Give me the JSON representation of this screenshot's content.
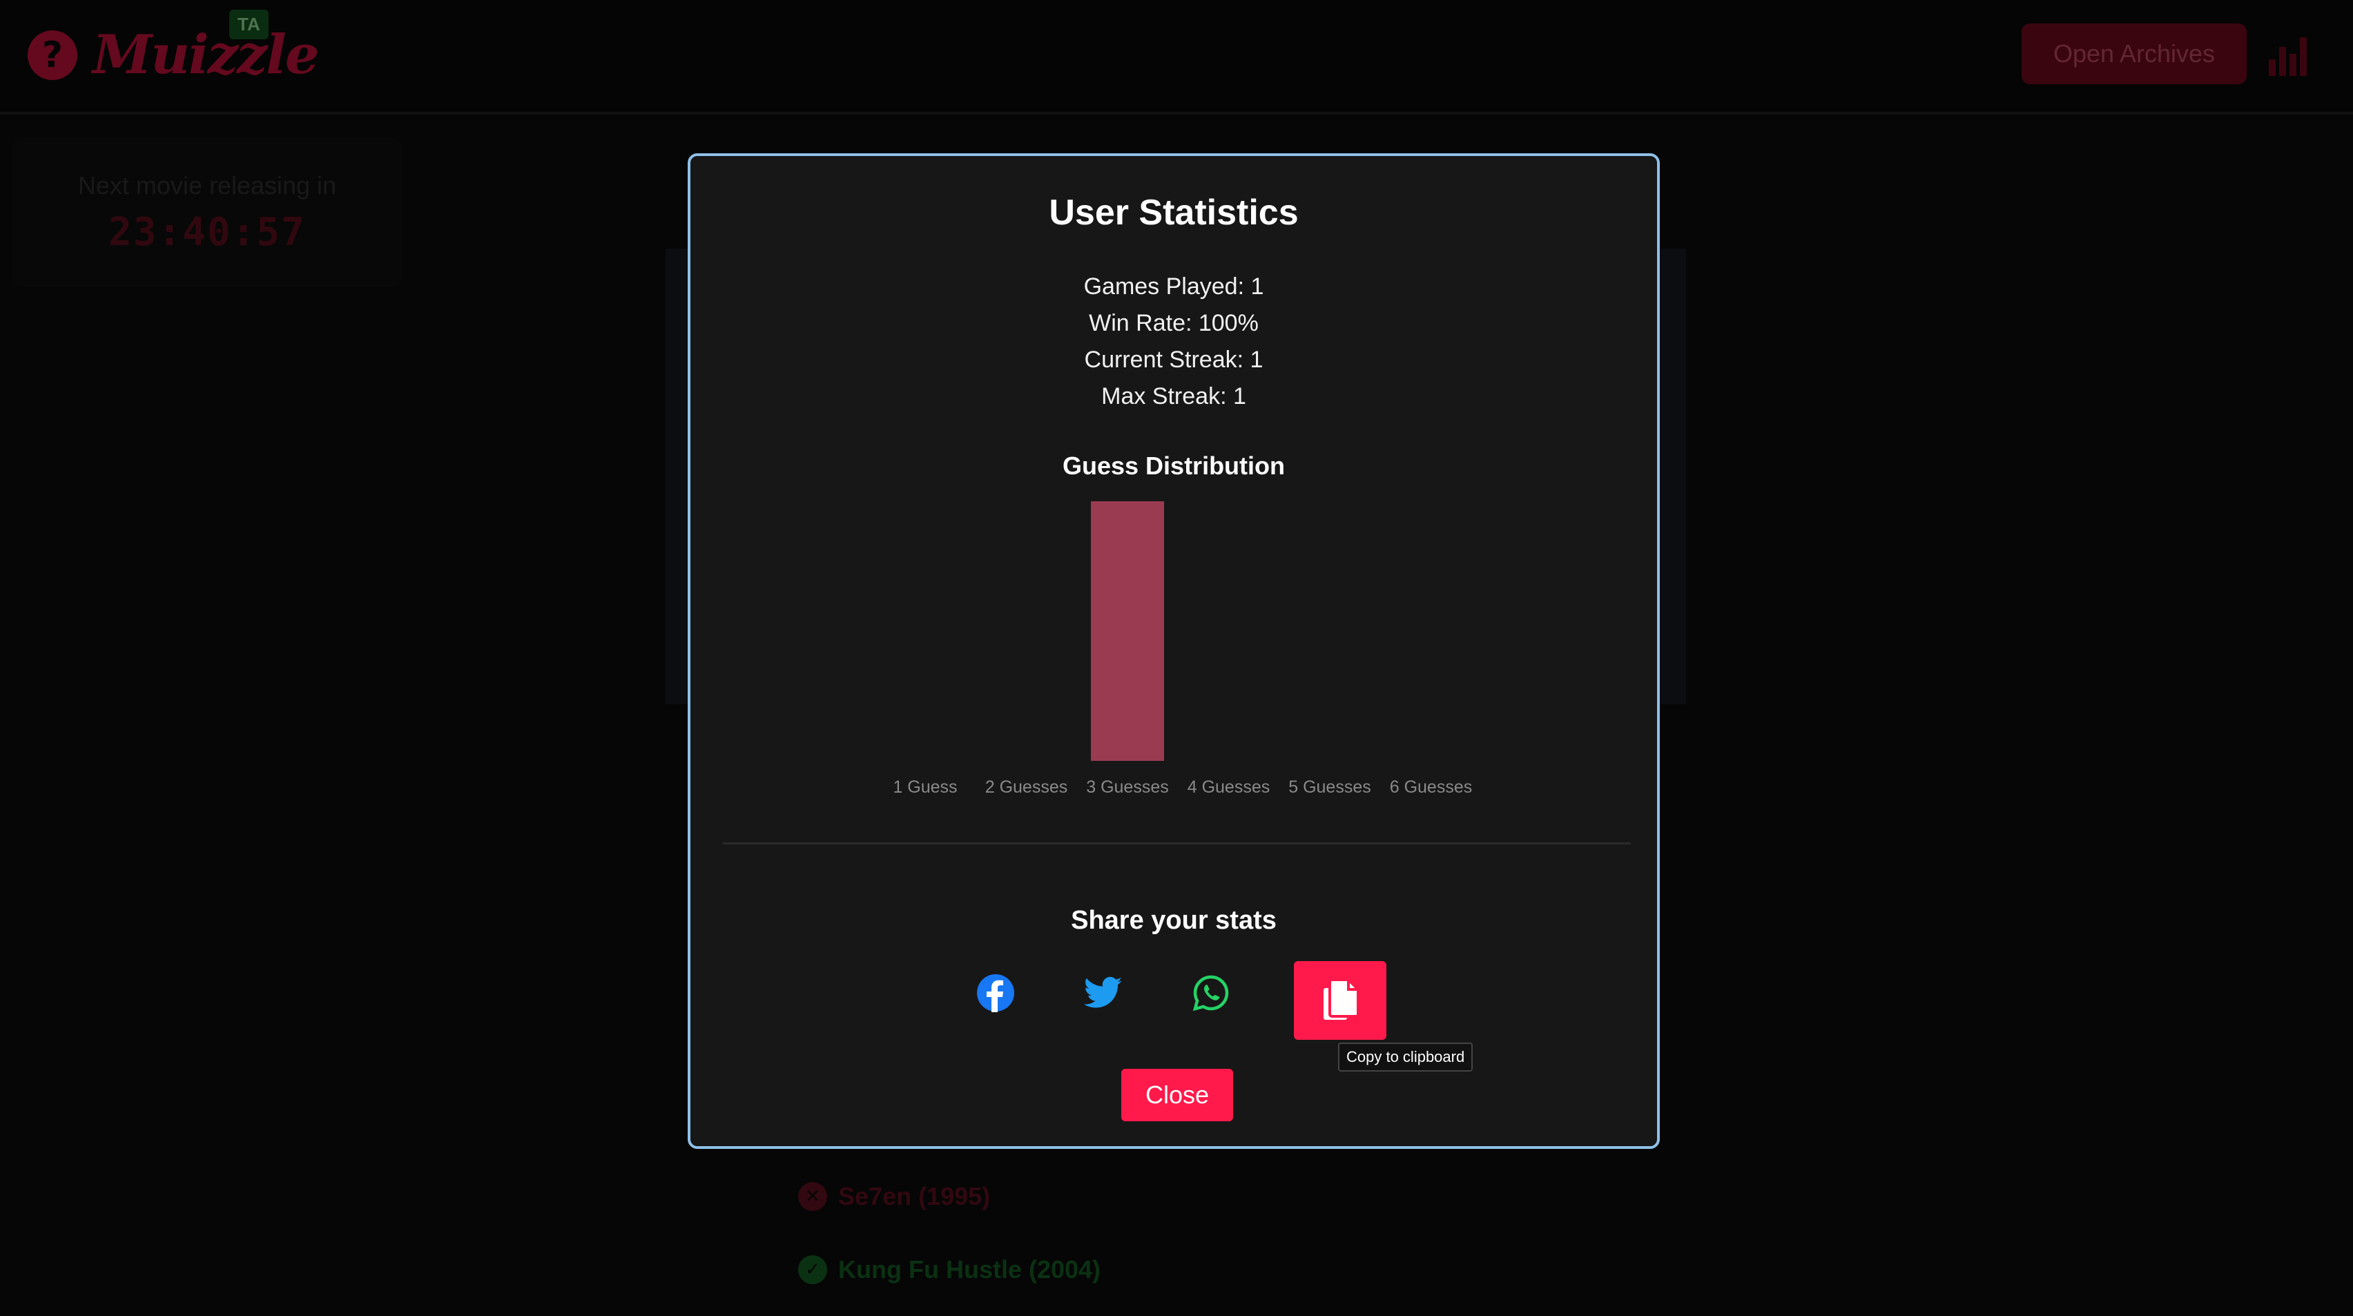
{
  "app": {
    "logo_text": "Muizzle",
    "logo_symbol": "?",
    "language_badge": "TA",
    "archives_label": "Open Archives",
    "stats_icon": "bar-chart-icon"
  },
  "countdown": {
    "label": "Next movie releasing in",
    "time": "23:40:57"
  },
  "guesses": [
    {
      "title": "Se7en (1995)",
      "status": "wrong",
      "icon": "x-circle-icon"
    },
    {
      "title": "Kung Fu Hustle (2004)",
      "status": "correct",
      "icon": "check-circle-icon"
    }
  ],
  "modal": {
    "title": "User Statistics",
    "stats": [
      "Games Played: 1",
      "Win Rate: 100%",
      "Current Streak: 1",
      "Max Streak: 1"
    ],
    "distribution_title": "Guess Distribution",
    "share_title": "Share your stats",
    "share_icons": [
      "facebook-icon",
      "twitter-icon",
      "whatsapp-icon",
      "clipboard-icon"
    ],
    "copy_tooltip": "Copy to clipboard",
    "close_label": "Close"
  },
  "chart_data": {
    "type": "bar",
    "title": "Guess Distribution",
    "categories": [
      "1 Guess",
      "2 Guesses",
      "3 Guesses",
      "4 Guesses",
      "5 Guesses",
      "6 Guesses"
    ],
    "values": [
      0,
      0,
      1,
      0,
      0,
      0
    ],
    "ylim": [
      0,
      1
    ],
    "grid": false,
    "bar_color": "#9b3b52"
  },
  "colors": {
    "accent": "#ff1a4b",
    "modal_border": "#8fc0e8",
    "facebook": "#1877f2",
    "twitter": "#1d9bf0",
    "whatsapp": "#25d366"
  }
}
